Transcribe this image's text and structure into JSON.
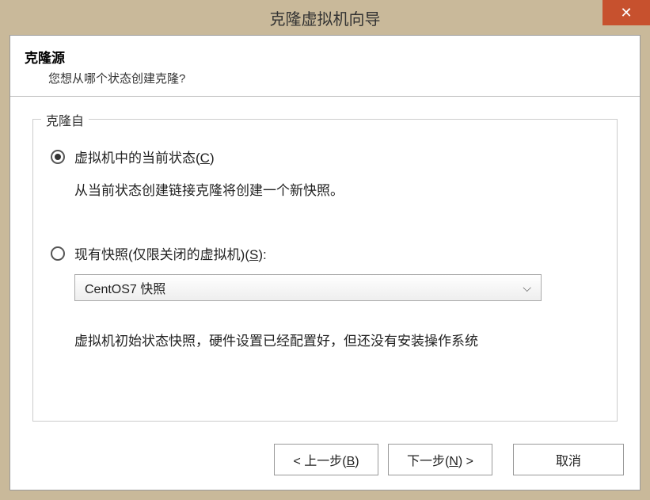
{
  "window": {
    "title": "克隆虚拟机向导"
  },
  "header": {
    "title": "克隆源",
    "subtitle": "您想从哪个状态创建克隆?"
  },
  "fieldset": {
    "legend": "克隆自"
  },
  "option1": {
    "label_pre": "虚拟机中的当前状态(",
    "label_key": "C",
    "label_post": ")",
    "description": "从当前状态创建链接克隆将创建一个新快照。"
  },
  "option2": {
    "label_pre": "现有快照(仅限关闭的虚拟机)(",
    "label_key": "S",
    "label_post": "):",
    "select_value": "CentOS7 快照",
    "description": "虚拟机初始状态快照，硬件设置已经配置好，但还没有安装操作系统"
  },
  "buttons": {
    "back_pre": "< 上一步(",
    "back_key": "B",
    "back_post": ")",
    "next_pre": "下一步(",
    "next_key": "N",
    "next_post": ") >",
    "cancel": "取消"
  }
}
